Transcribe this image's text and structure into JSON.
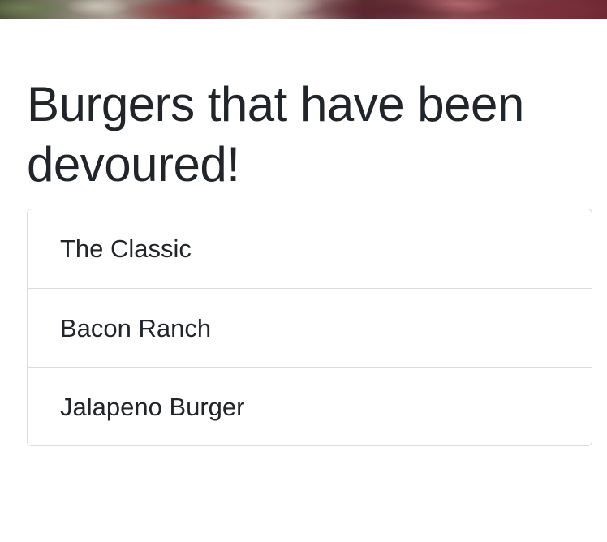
{
  "page": {
    "title": "Burgers that have been devoured!"
  },
  "devoured": {
    "items": [
      {
        "name": "The Classic"
      },
      {
        "name": "Bacon Ranch"
      },
      {
        "name": "Jalapeno Burger"
      }
    ]
  },
  "colors": {
    "text": "#212529",
    "border": "#dcdcdc",
    "background": "#ffffff"
  }
}
